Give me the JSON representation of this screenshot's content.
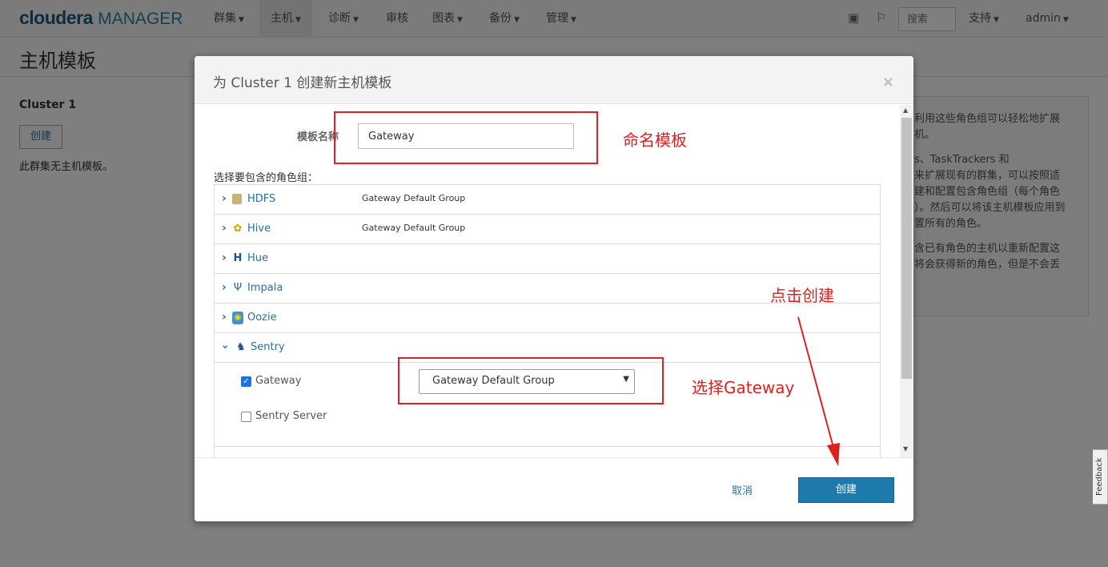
{
  "navbar": {
    "logo_bold": "cloudera",
    "logo_rest": "MANAGER",
    "items": [
      {
        "label": "群集"
      },
      {
        "label": "主机"
      },
      {
        "label": "诊断"
      },
      {
        "label": "审核"
      },
      {
        "label": "图表"
      },
      {
        "label": "备份"
      },
      {
        "label": "管理"
      }
    ],
    "search_placeholder": "搜索",
    "support": "支持",
    "user": "admin"
  },
  "page": {
    "title": "主机模板",
    "cluster": "Cluster 1",
    "create": "创建",
    "no_templates": "此群集无主机模板。",
    "help": [
      "利用这些角色组可以轻松地扩展",
      "机。",
      "s、TaskTrackers 和",
      "来扩展现有的群集，可以按照适",
      "建和配置包含角色组（每个角色",
      "）。然后可以将该主机模板应用到",
      "置所有的角色。",
      "含已有角色的主机以重新配置这",
      "将会获得新的角色，但是不会丢"
    ]
  },
  "modal": {
    "title": "为 Cluster 1 创建新主机模板",
    "close": "×",
    "name_label": "模板名称",
    "name_value": "Gateway",
    "roles_label": "选择要包含的角色组：",
    "services": [
      {
        "name": "HDFS",
        "group": "Gateway Default Group"
      },
      {
        "name": "Hive",
        "group": "Gateway Default Group"
      },
      {
        "name": "Hue",
        "group": ""
      },
      {
        "name": "Impala",
        "group": ""
      },
      {
        "name": "Oozie",
        "group": ""
      },
      {
        "name": "Sentry",
        "group": ""
      }
    ],
    "sentry_roles": [
      {
        "name": "Gateway",
        "checked": true,
        "group": "Gateway Default Group"
      },
      {
        "name": "Sentry Server",
        "checked": false
      }
    ],
    "cancel": "取消",
    "create": "创建"
  },
  "annotations": {
    "name_template": "命名模板",
    "click_create": "点击创建",
    "select_gateway": "选择Gateway",
    "color": "#e02020"
  },
  "feedback": "Feedback"
}
